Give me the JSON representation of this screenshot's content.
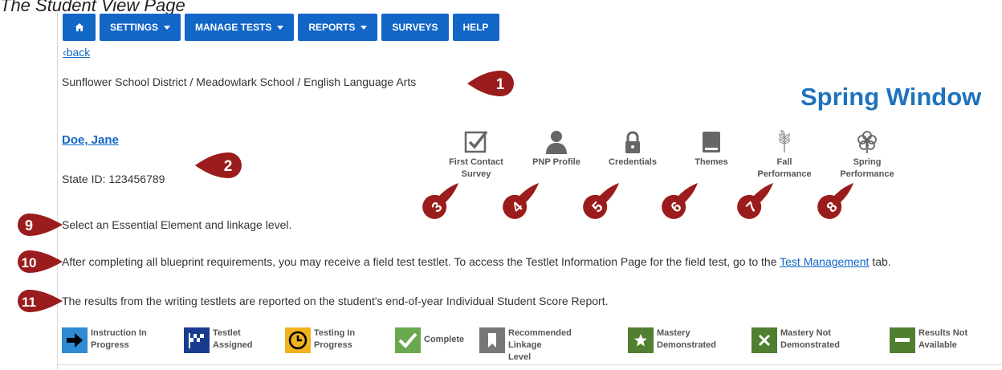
{
  "doc_title": "The Student View Page",
  "navbar": {
    "home_icon": "home-icon",
    "items": [
      {
        "label": "SETTINGS",
        "dropdown": true
      },
      {
        "label": "MANAGE TESTS",
        "dropdown": true
      },
      {
        "label": "REPORTS",
        "dropdown": true
      },
      {
        "label": "SURVEYS",
        "dropdown": false
      },
      {
        "label": "HELP",
        "dropdown": false
      }
    ],
    "color": "#1266c6"
  },
  "back_link": "‹back",
  "breadcrumb": "Sunflower School District / Meadowlark School / English Language Arts",
  "window_title": "Spring Window",
  "student": {
    "name": "Doe, Jane",
    "state_id": "State ID: 123456789"
  },
  "tools": [
    {
      "icon": "checkbox-icon",
      "line1": "First Contact",
      "line2": "Survey"
    },
    {
      "icon": "person-icon",
      "line1": "PNP Profile",
      "line2": ""
    },
    {
      "icon": "lock-icon",
      "line1": "Credentials",
      "line2": ""
    },
    {
      "icon": "book-icon",
      "line1": "Themes",
      "line2": ""
    },
    {
      "icon": "leaf-icon",
      "line1": "Fall",
      "line2": "Performance"
    },
    {
      "icon": "flower-icon",
      "line1": "Spring",
      "line2": "Performance"
    }
  ],
  "instructions": {
    "select": "Select an Essential Element and linkage level.",
    "field_test_before": "After completing all blueprint requirements, you may receive a field test testlet. To access the Testlet Information Page for the field test, go to the ",
    "field_test_link": "Test Management",
    "field_test_after": " tab.",
    "writing": "The results from the writing testlets are reported on the student's end-of-year Individual Student Score Report."
  },
  "callouts": [
    "1",
    "2",
    "3",
    "4",
    "5",
    "6",
    "7",
    "8",
    "9",
    "10",
    "11"
  ],
  "callout_color": "#9b1c1c",
  "legend": [
    {
      "icon": "arrow-right-icon",
      "line1": "Instruction In",
      "line2": "Progress",
      "color": "#2e8bd4"
    },
    {
      "icon": "checkered-flag-icon",
      "line1": "Testlet",
      "line2": "Assigned",
      "color": "#1a3c8f"
    },
    {
      "icon": "clock-icon",
      "line1": "Testing In",
      "line2": "Progress",
      "color": "#f0b21e"
    },
    {
      "icon": "checkmark-icon",
      "line1": "Complete",
      "line2": "",
      "color": "#6aa84f"
    },
    {
      "icon": "bookmark-icon",
      "line1": "Recommended Linkage",
      "line2": "Level",
      "color": "#777777"
    },
    {
      "icon": "star-icon",
      "line1": "Mastery",
      "line2": "Demonstrated",
      "color": "#4f7f2f"
    },
    {
      "icon": "x-icon",
      "line1": "Mastery Not",
      "line2": "Demonstrated",
      "color": "#4f7f2f"
    },
    {
      "icon": "minus-icon",
      "line1": "Results Not",
      "line2": "Available",
      "color": "#4f7f2f"
    }
  ]
}
